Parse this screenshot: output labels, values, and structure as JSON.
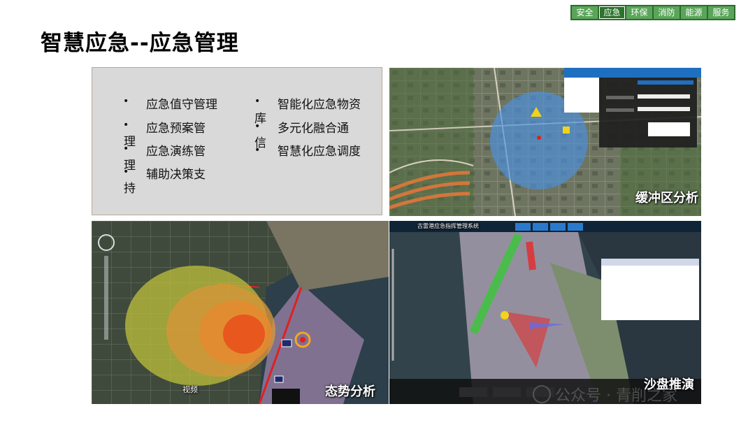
{
  "tabs": [
    "安全",
    "应急",
    "环保",
    "消防",
    "能源",
    "服务"
  ],
  "title": "智慧应急--应急管理",
  "left_items": [
    "应急值守管理",
    "应急预案管",
    "应急演练管",
    "辅助决策支"
  ],
  "left_fragments": [
    "理",
    "理",
    "持"
  ],
  "right_items": [
    "智能化应急物资",
    "多元化融合通",
    "智慧化应急调度"
  ],
  "right_fragments": [
    "库",
    "信"
  ],
  "panels": {
    "buffer": "缓冲区分析",
    "situation": "态势分析",
    "sandbox": "沙盘推演"
  },
  "situation_overlay": {
    "video_label": "视频"
  },
  "sandbox_header": {
    "system_title": "古雷港应急指挥管理系统"
  },
  "watermark": "公众号 · 青削之家",
  "colors": {
    "tab_bg": "#5aa55a",
    "tab_active": "#2b742b",
    "buffer_circle": "#4a90e2",
    "hazard_outer": "#c8c83a",
    "hazard_core": "#e8541c"
  }
}
